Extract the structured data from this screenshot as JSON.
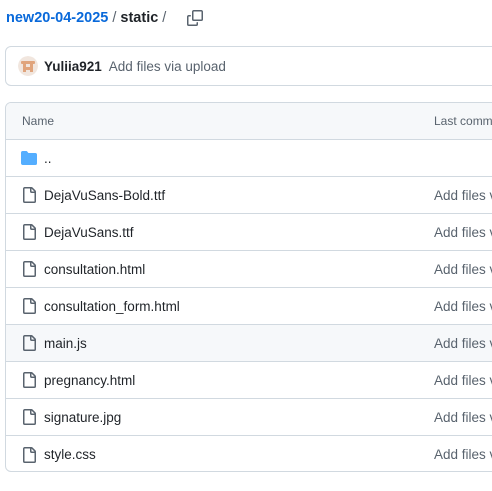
{
  "breadcrumb": {
    "repo": "new20-04-2025",
    "separator": "/",
    "current": "static",
    "trailing_separator": "/"
  },
  "latest_commit": {
    "author": "Yuliia921",
    "message": "Add files via upload",
    "avatar_icon": "identicon-avatar",
    "avatar_color": "#e0a47c"
  },
  "table": {
    "headers": {
      "name": "Name",
      "last_commit": "Last commit"
    },
    "rows": [
      {
        "name": "..",
        "type": "parent-folder",
        "icon": "folder-icon",
        "commit": ""
      },
      {
        "name": "DejaVuSans-Bold.ttf",
        "type": "file",
        "icon": "file-icon",
        "commit": "Add files v"
      },
      {
        "name": "DejaVuSans.ttf",
        "type": "file",
        "icon": "file-icon",
        "commit": "Add files v"
      },
      {
        "name": "consultation.html",
        "type": "file",
        "icon": "file-icon",
        "commit": "Add files v"
      },
      {
        "name": "consultation_form.html",
        "type": "file",
        "icon": "file-icon",
        "commit": "Add files v"
      },
      {
        "name": "main.js",
        "type": "file",
        "icon": "file-icon",
        "commit": "Add files v",
        "highlighted": true
      },
      {
        "name": "pregnancy.html",
        "type": "file",
        "icon": "file-icon",
        "commit": "Add files v"
      },
      {
        "name": "signature.jpg",
        "type": "file",
        "icon": "file-icon",
        "commit": "Add files v"
      },
      {
        "name": "style.css",
        "type": "file",
        "icon": "file-icon",
        "commit": "Add files v"
      }
    ]
  },
  "colors": {
    "link": "#0969da",
    "folder": "#54aeff",
    "muted": "#59636e",
    "border": "#d1d9e0",
    "header_bg": "#f6f8fa"
  }
}
